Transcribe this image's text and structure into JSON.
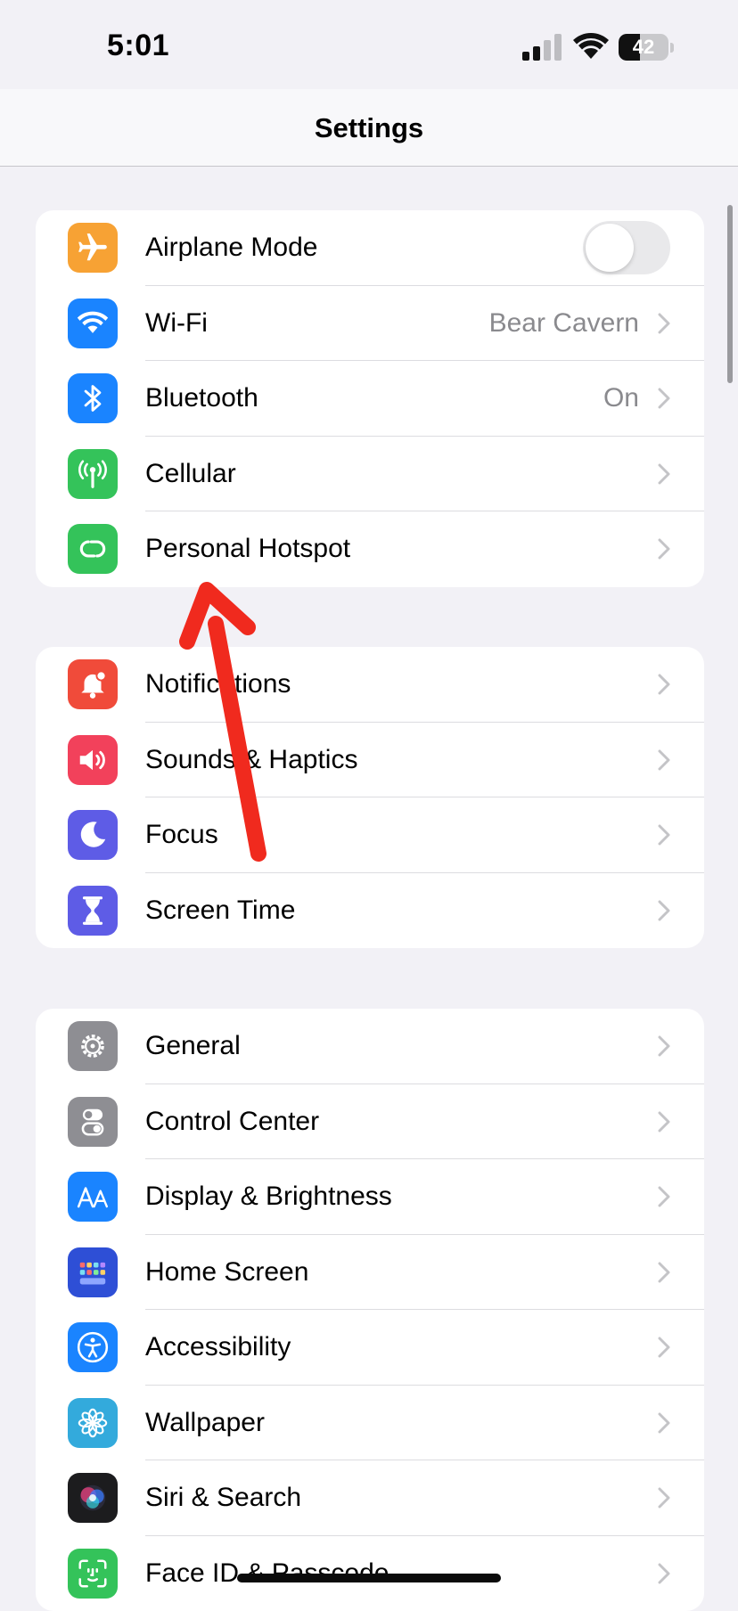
{
  "status": {
    "time": "5:01",
    "battery": "42",
    "battery_level": 0.42
  },
  "nav": {
    "title": "Settings"
  },
  "groups": [
    {
      "rows": [
        {
          "label": "Airplane Mode",
          "icon": "airplane-icon",
          "color": "#f7a234",
          "control": "toggle",
          "toggle_on": false
        },
        {
          "label": "Wi-Fi",
          "icon": "wifi-icon",
          "color": "#1a84ff",
          "value": "Bear Cavern"
        },
        {
          "label": "Bluetooth",
          "icon": "bluetooth-icon",
          "color": "#1a84ff",
          "value": "On"
        },
        {
          "label": "Cellular",
          "icon": "cellular-antenna-icon",
          "color": "#34c35a"
        },
        {
          "label": "Personal Hotspot",
          "icon": "hotspot-icon",
          "color": "#34c35a"
        }
      ]
    },
    {
      "rows": [
        {
          "label": "Notifications",
          "icon": "notifications-bell-icon",
          "color": "#f04b3a"
        },
        {
          "label": "Sounds & Haptics",
          "icon": "speaker-icon",
          "color": "#f2415b"
        },
        {
          "label": "Focus",
          "icon": "moon-icon",
          "color": "#5e5ce6"
        },
        {
          "label": "Screen Time",
          "icon": "hourglass-icon",
          "color": "#5e5ce6"
        }
      ]
    },
    {
      "rows": [
        {
          "label": "General",
          "icon": "gear-icon",
          "color": "#8e8e93"
        },
        {
          "label": "Control Center",
          "icon": "switches-icon",
          "color": "#8e8e93"
        },
        {
          "label": "Display & Brightness",
          "icon": "text-size-icon",
          "color": "#1a84ff"
        },
        {
          "label": "Home Screen",
          "icon": "app-grid-icon",
          "color": "#2e4fd6"
        },
        {
          "label": "Accessibility",
          "icon": "accessibility-icon",
          "color": "#1a84ff"
        },
        {
          "label": "Wallpaper",
          "icon": "flower-icon",
          "color": "#33aadc"
        },
        {
          "label": "Siri & Search",
          "icon": "siri-icon",
          "color": "#1c1c1e"
        },
        {
          "label": "Face ID & Passcode",
          "icon": "face-id-icon",
          "color": "#34c35a"
        }
      ]
    }
  ]
}
